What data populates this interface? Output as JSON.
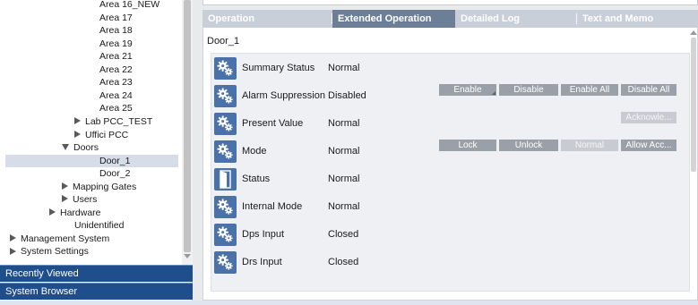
{
  "tree": {
    "nodes": [
      {
        "label": "Area 16_NEW",
        "indent": 110,
        "arrow": "none"
      },
      {
        "label": "Area 17",
        "indent": 110,
        "arrow": "none"
      },
      {
        "label": "Area 18",
        "indent": 110,
        "arrow": "none"
      },
      {
        "label": "Area 19",
        "indent": 110,
        "arrow": "none"
      },
      {
        "label": "Area 21",
        "indent": 110,
        "arrow": "none"
      },
      {
        "label": "Area 22",
        "indent": 110,
        "arrow": "none"
      },
      {
        "label": "Area 23",
        "indent": 110,
        "arrow": "none"
      },
      {
        "label": "Area 24",
        "indent": 110,
        "arrow": "none"
      },
      {
        "label": "Area 25",
        "indent": 110,
        "arrow": "none"
      },
      {
        "label": "Lab PCC_TEST",
        "indent": 96,
        "arrow": "right"
      },
      {
        "label": "Uffici PCC",
        "indent": 96,
        "arrow": "right"
      },
      {
        "label": "Doors",
        "indent": 82,
        "arrow": "down"
      },
      {
        "label": "Door_1",
        "indent": 110,
        "arrow": "none",
        "selected": true
      },
      {
        "label": "Door_2",
        "indent": 110,
        "arrow": "none"
      },
      {
        "label": "Mapping Gates",
        "indent": 82,
        "arrow": "right"
      },
      {
        "label": "Users",
        "indent": 82,
        "arrow": "right"
      },
      {
        "label": "Hardware",
        "indent": 68,
        "arrow": "right"
      },
      {
        "label": "Unidentified",
        "indent": 82,
        "arrow": "none"
      },
      {
        "label": "Management System",
        "indent": 24,
        "arrow": "right"
      },
      {
        "label": "System Settings",
        "indent": 24,
        "arrow": "right"
      }
    ]
  },
  "nav": {
    "recently_viewed": "Recently Viewed",
    "system_browser": "System Browser"
  },
  "tabs": [
    {
      "label": "Operation",
      "active": false
    },
    {
      "label": "Extended Operation",
      "active": true
    },
    {
      "label": "Detailed Log",
      "active": false
    },
    {
      "label": "Text and Memo",
      "active": false
    }
  ],
  "object_title": "Door_1",
  "properties": [
    {
      "label": "Summary Status",
      "value": "Normal",
      "icon": "gears-icon",
      "commands": []
    },
    {
      "label": "Alarm Suppression",
      "value": "Disabled",
      "icon": "gears-icon",
      "commands": [
        {
          "label": "Enable",
          "enabled": true,
          "corner": true
        },
        {
          "label": "Disable",
          "enabled": true
        },
        {
          "label": "Enable All",
          "enabled": true
        },
        {
          "label": "Disable All",
          "enabled": true
        }
      ]
    },
    {
      "label": "Present Value",
      "value": "Normal",
      "icon": "gears-icon",
      "commands": [
        {
          "label": "Acknowle...",
          "enabled": false
        }
      ]
    },
    {
      "label": "Mode",
      "value": "Normal",
      "icon": "gears-icon",
      "commands": [
        {
          "label": "Lock",
          "enabled": true
        },
        {
          "label": "Unlock",
          "enabled": true
        },
        {
          "label": "Normal",
          "enabled": false
        },
        {
          "label": "Allow Acc...",
          "enabled": true
        }
      ]
    },
    {
      "label": "Status",
      "value": "Normal",
      "icon": "door-icon",
      "commands": []
    },
    {
      "label": "Internal Mode",
      "value": "Normal",
      "icon": "gears-icon",
      "commands": []
    },
    {
      "label": "Dps Input",
      "value": "Closed",
      "icon": "gears-icon",
      "commands": []
    },
    {
      "label": "Drs Input",
      "value": "Closed",
      "icon": "gears-icon",
      "commands": []
    }
  ]
}
